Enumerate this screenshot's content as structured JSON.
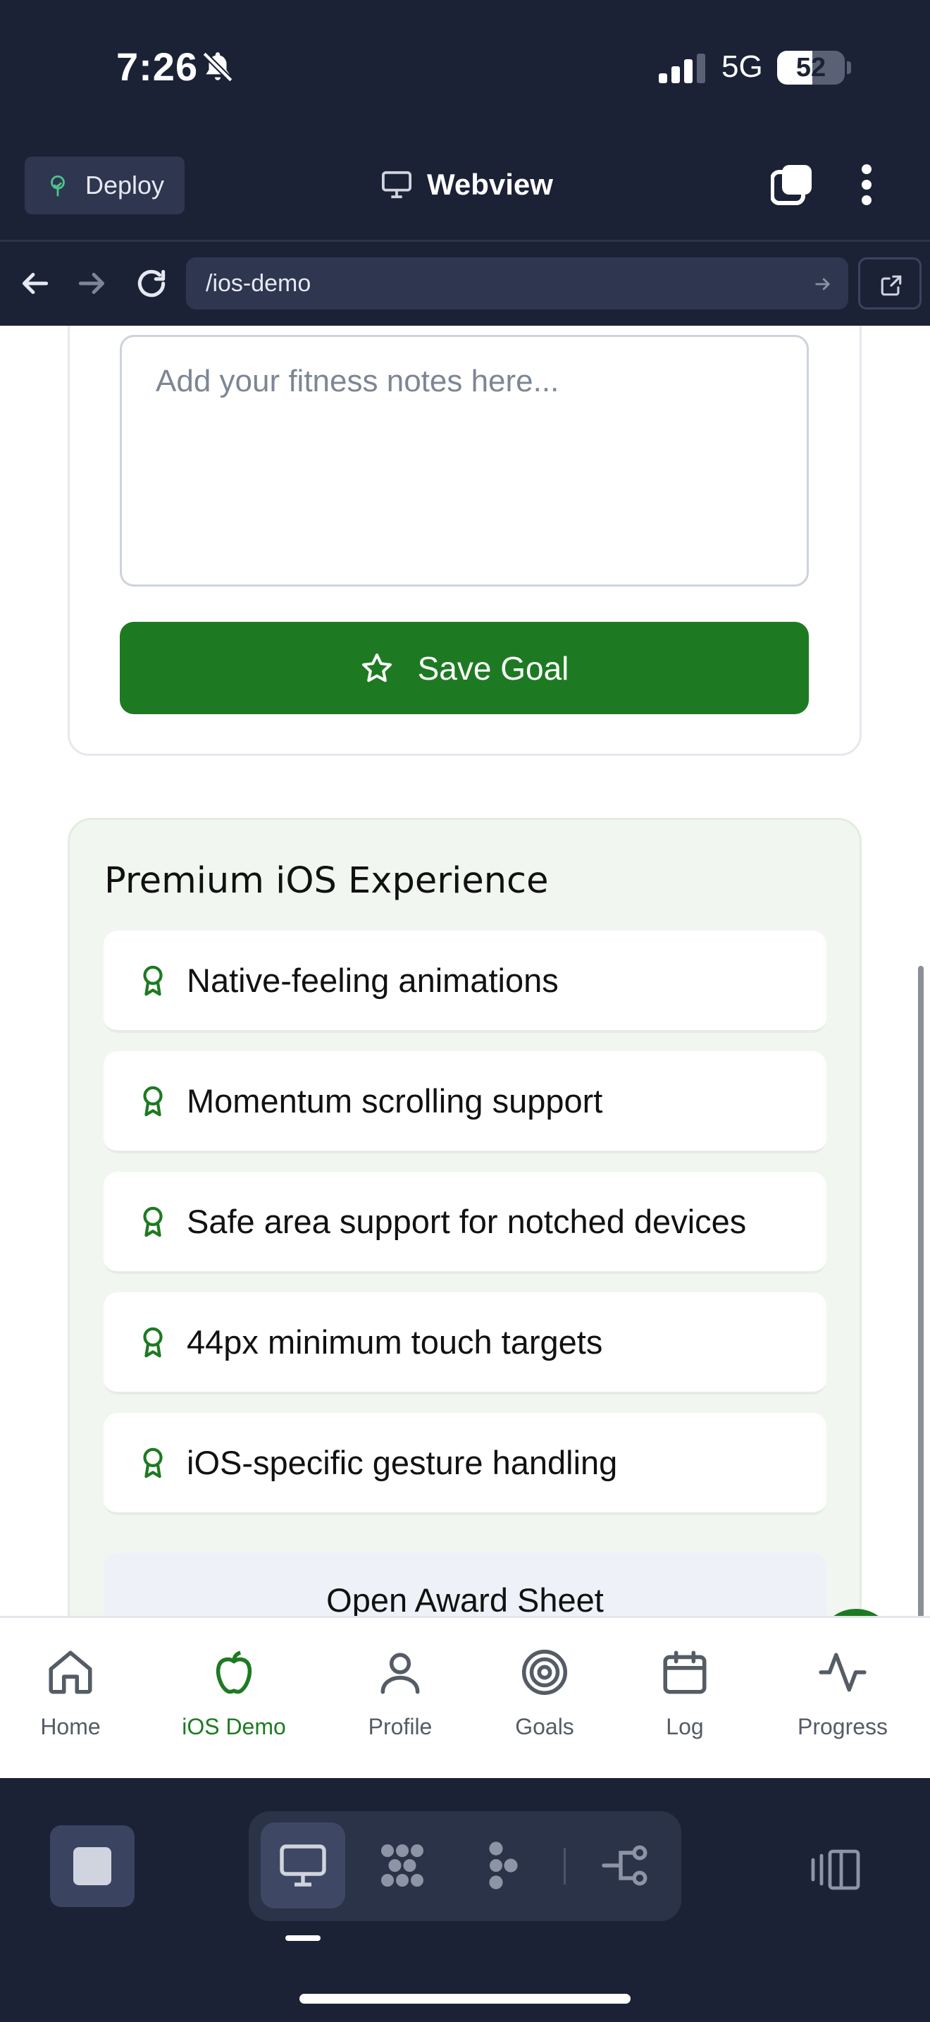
{
  "status_bar": {
    "time": "7:26",
    "network": "5G",
    "battery_level": "52",
    "battery_fraction": 0.52
  },
  "toolbar": {
    "deploy_label": "Deploy",
    "title": "Webview"
  },
  "url_bar": {
    "path": "/ios-demo"
  },
  "form": {
    "notes_placeholder": "Add your fitness notes here...",
    "save_label": "Save Goal"
  },
  "premium": {
    "title": "Premium iOS Experience",
    "features": [
      "Native-feeling animations",
      "Momentum scrolling support",
      "Safe area support for notched devices",
      "44px minimum touch targets",
      "iOS-specific gesture handling"
    ],
    "award_button": "Open Award Sheet"
  },
  "bottom_nav": {
    "active": "iOS Demo",
    "items": [
      {
        "label": "Home",
        "icon": "home-icon"
      },
      {
        "label": "iOS Demo",
        "icon": "apple-icon"
      },
      {
        "label": "Profile",
        "icon": "user-icon"
      },
      {
        "label": "Goals",
        "icon": "target-icon"
      },
      {
        "label": "Log",
        "icon": "calendar-icon"
      },
      {
        "label": "Progress",
        "icon": "activity-icon"
      }
    ]
  },
  "colors": {
    "accent": "#1e7a22",
    "chrome": "#1b2236",
    "panel": "#f1f6f1"
  }
}
